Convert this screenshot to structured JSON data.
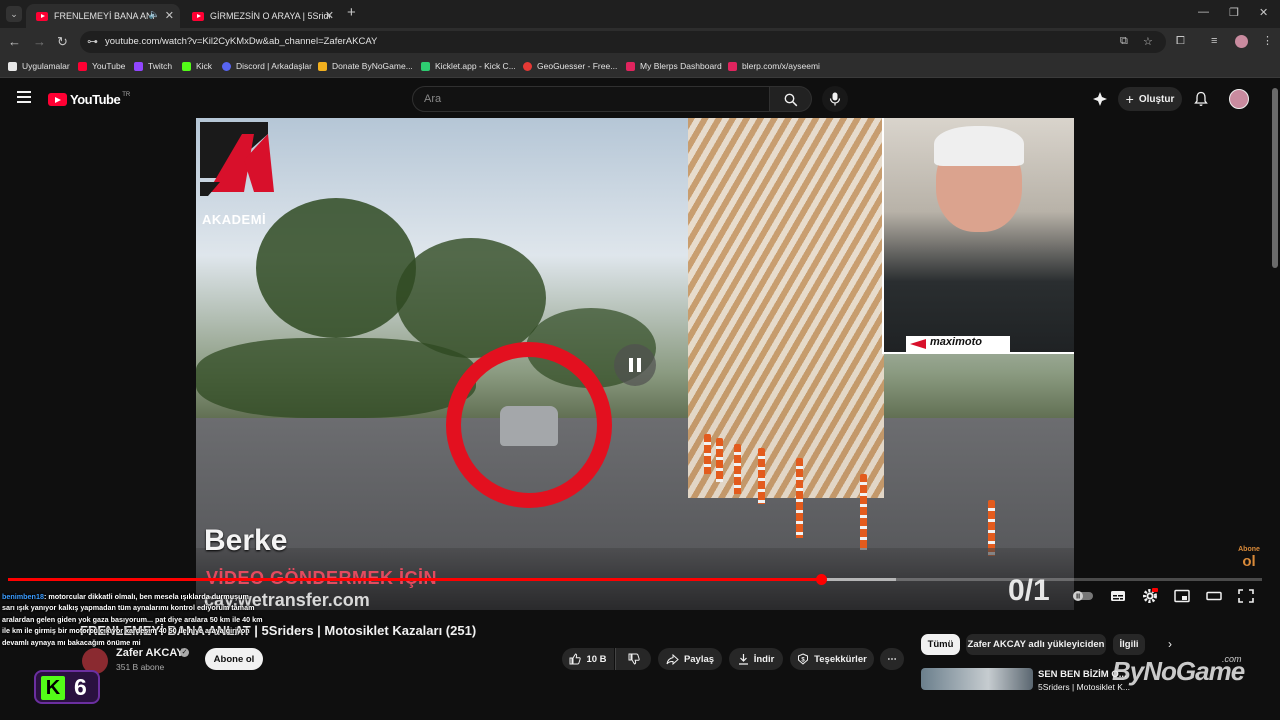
{
  "browser": {
    "tabs": [
      {
        "title": "FRENLEMEYİ BANA ANLAT",
        "active": true
      },
      {
        "title": "GİRMEZSİN O ARAYA | 5Sriders",
        "active": false
      }
    ],
    "new_tab": "+",
    "url": "youtube.com/watch?v=Kil2CyKMxDw&ab_channel=ZaferAKCAY",
    "bookmarks": [
      {
        "label": "Uygulamalar",
        "color": "#e8e8e8"
      },
      {
        "label": "YouTube",
        "color": "#ff0033"
      },
      {
        "label": "Twitch",
        "color": "#9146ff"
      },
      {
        "label": "Kick",
        "color": "#53fc18"
      },
      {
        "label": "Discord | Arkadaşlar",
        "color": "#5865f2"
      },
      {
        "label": "Donate ByNoGame...",
        "color": "#f2b01e"
      },
      {
        "label": "Kicklet.app - Kick C...",
        "color": "#2ecc71"
      },
      {
        "label": "GeoGuesser - Free...",
        "color": "#e53935"
      },
      {
        "label": "My Blerps Dashboard",
        "color": "#e0245e"
      },
      {
        "label": "blerp.com/x/ayseemi",
        "color": "#e0245e"
      }
    ]
  },
  "youtube": {
    "logo_text": "YouTube",
    "region": "TR",
    "search_placeholder": "Ara",
    "create_label": "Oluştur"
  },
  "video": {
    "overlay_logo": "AKADEMİ",
    "overlay_name": "Berke",
    "overlay_line1": "VİDEO GÖNDERMEK İÇİN",
    "overlay_line2": "cay.wetransfer.com",
    "overlay_counter": "0/1",
    "sponsor": "maximoto",
    "progress_played": 0.648,
    "progress_buffered": 0.708,
    "subscribe_watermark_small": "Abone",
    "subscribe_watermark_big": "ol",
    "title": "FRENLEMEYİ BANA ANLAT | 5Sriders | Motosiklet Kazaları (251)",
    "channel": "Zafer AKCAY",
    "subscribers": "351 B abone",
    "subscribe_label": "Abone ol",
    "likes": "10 B",
    "share_label": "Paylaş",
    "download_label": "İndir",
    "thanks_label": "Teşekkürler",
    "more_label": "⋯"
  },
  "sidebar": {
    "chips": [
      "Tümü",
      "Zafer AKCAY adlı yükleyiciden",
      "İlgili"
    ],
    "rec_title": "SEN BEN BİZİM O...",
    "rec_sub": "5Sriders | Motosiklet K..."
  },
  "chat": {
    "user": "benimben18",
    "message_lines": [
      ": motorcular dikkatli olmalı, ben mesela ışıklarda durmuşum",
      "sarı ışık yanıyor kalkış yapmadan tüm aynalarımı kontrol ediyorum tamam",
      "aralardan gelen giden yok gaza basıyorum... pat diye aralara 50 km ile 40 km",
      "ile km ile girmiş bir motorcu çıkıyor kardeşim 40 50 ile niye araya giriyon",
      "devamlı aynaya mı bakacağım önüme mi"
    ],
    "kick_badge": "6"
  },
  "watermark": {
    "text": "ByNoGame",
    "suffix": ".com"
  }
}
